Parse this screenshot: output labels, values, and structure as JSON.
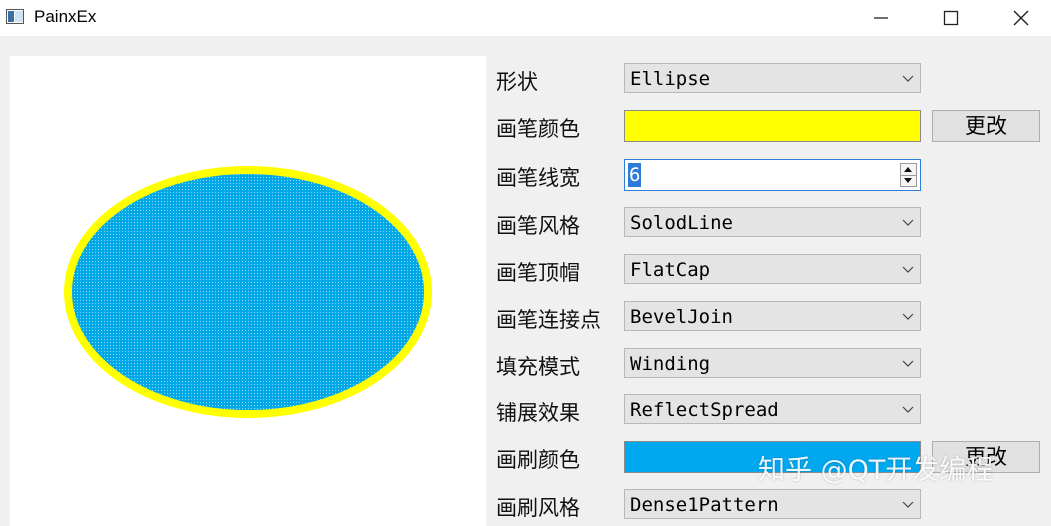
{
  "window": {
    "title": "PainxEx",
    "controls": [
      "minimize-icon",
      "maximize-icon",
      "close-icon"
    ]
  },
  "canvas": {
    "shape": "ellipse",
    "fill_color": "#00a8e8",
    "pen_color": "#ffff00",
    "brush_pattern": "Dense1Pattern"
  },
  "form": {
    "shape": {
      "label": "形状",
      "value": "Ellipse"
    },
    "pen_color": {
      "label": "画笔颜色",
      "color": "#ffff00",
      "button": "更改"
    },
    "pen_width": {
      "label": "画笔线宽",
      "value": "6"
    },
    "pen_style": {
      "label": "画笔风格",
      "value": "SolodLine"
    },
    "pen_cap": {
      "label": "画笔顶帽",
      "value": "FlatCap"
    },
    "pen_join": {
      "label": "画笔连接点",
      "value": "BevelJoin"
    },
    "fill_rule": {
      "label": "填充模式",
      "value": "Winding"
    },
    "spread": {
      "label": "铺展效果",
      "value": "ReflectSpread"
    },
    "brush_color": {
      "label": "画刷颜色",
      "color": "#00a8f0",
      "button": "更改"
    },
    "brush_style": {
      "label": "画刷风格",
      "value": "Dense1Pattern"
    }
  },
  "watermark": "知乎 @QT开发编程"
}
